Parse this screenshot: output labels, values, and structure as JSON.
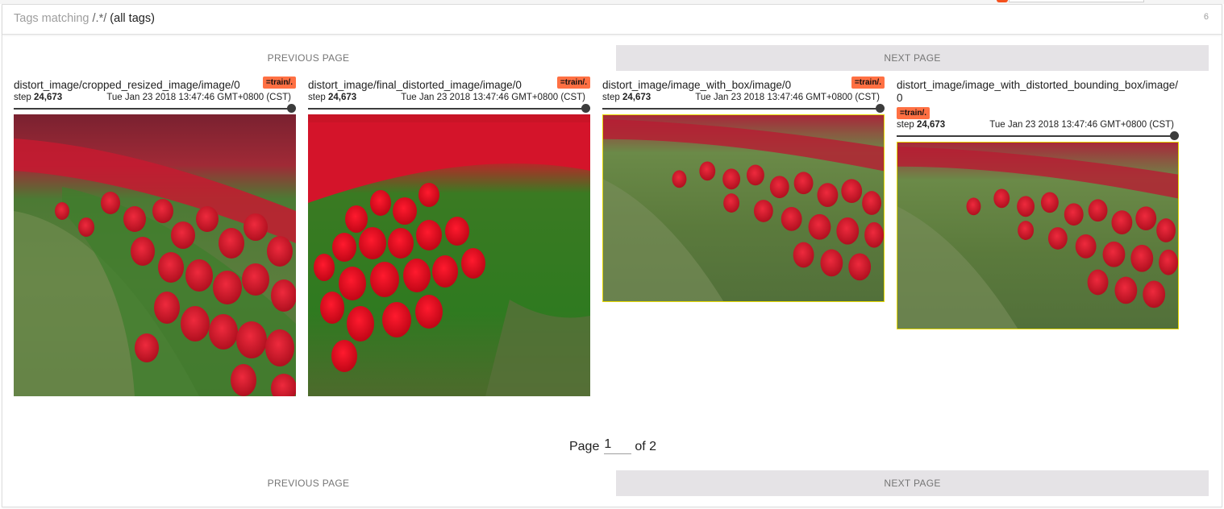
{
  "header": {
    "tags_label": "Tags matching",
    "tags_regex": "/.*/",
    "tags_desc": "(all tags)",
    "tag_count": "6"
  },
  "pager": {
    "previous_label": "PREVIOUS PAGE",
    "next_label": "NEXT PAGE",
    "page_label": "Page",
    "page_value": "1",
    "page_of": "of 2"
  },
  "cards": [
    {
      "title": "distort_image/cropped_resized_image/image/0",
      "run": "=train/.",
      "step_label": "step",
      "step_value": "24,673",
      "time": "Tue Jan 23 2018 13:47:46 GMT+0800 (CST)"
    },
    {
      "title": "distort_image/final_distorted_image/image/0",
      "run": "=train/.",
      "step_label": "step",
      "step_value": "24,673",
      "time": "Tue Jan 23 2018 13:47:46 GMT+0800 (CST)"
    },
    {
      "title": "distort_image/image_with_box/image/0",
      "run": "=train/.",
      "step_label": "step",
      "step_value": "24,673",
      "time": "Tue Jan 23 2018 13:47:46 GMT+0800 (CST)"
    },
    {
      "title": "distort_image/image_with_distorted_bounding_box/image/0",
      "run": "=train/.",
      "step_label": "step",
      "step_value": "24,673",
      "time": "Tue Jan 23 2018 13:47:46 GMT+0800 (CST)"
    }
  ],
  "colors": {
    "run_badge": "#ff7043",
    "next_button_bg": "#e5e3e6",
    "bbox_outline": "#e6d800",
    "tulip_red": "#d0142c",
    "stem_green": "#3f7d2c"
  }
}
